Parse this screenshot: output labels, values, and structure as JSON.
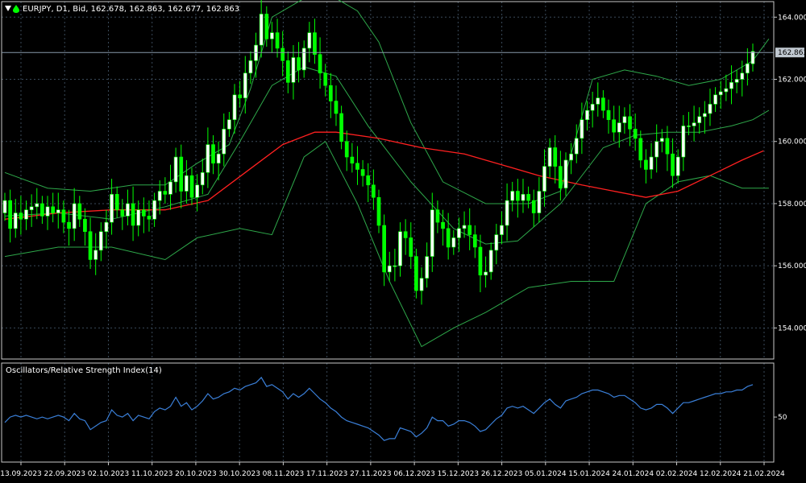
{
  "header": {
    "title": "EURJPY, D1, Bid, 162.678, 162.863, 162.677, 162.863",
    "arrow_icon": "triangle-down-icon",
    "status_icon": "green-drop-icon"
  },
  "colors": {
    "background": "#000000",
    "grid": "#3a4a5a",
    "frame": "#c8c8c8",
    "bull": "#ffffff",
    "bear": "#00ff00",
    "bollinger": "#2ea84a",
    "moving_average": "#ff2020",
    "rsi": "#3a7fd8",
    "price_line": "#8899aa",
    "price_tag_bg": "#c0c8d0"
  },
  "chart_data": [
    {
      "type": "candlestick",
      "symbol": "EURJPY",
      "timeframe": "D1",
      "ylim": [
        153.0,
        164.5
      ],
      "yticks": [
        "164.000",
        "162.000",
        "160.000",
        "158.000",
        "156.000",
        "154.000"
      ],
      "current_price": "162.863",
      "x_labels": [
        "13.09.2023",
        "22.09.2023",
        "02.10.2023",
        "11.10.2023",
        "20.10.2023",
        "30.10.2023",
        "08.11.2023",
        "17.11.2023",
        "27.11.2023",
        "06.12.2023",
        "15.12.2023",
        "26.12.2023",
        "05.01.2024",
        "15.01.2024",
        "24.01.2024",
        "02.02.2024",
        "12.02.2024",
        "21.02.2024"
      ],
      "closes": [
        158.1,
        157.2,
        157.7,
        157.5,
        157.8,
        157.9,
        158.0,
        157.6,
        157.9,
        157.7,
        157.8,
        157.4,
        157.2,
        158.0,
        157.5,
        157.1,
        156.2,
        156.5,
        157.1,
        157.4,
        158.3,
        157.8,
        157.6,
        158.0,
        157.3,
        157.8,
        157.6,
        157.5,
        158.1,
        158.4,
        158.3,
        158.7,
        159.5,
        158.4,
        158.9,
        158.2,
        158.6,
        159.0,
        159.9,
        159.3,
        159.6,
        160.4,
        160.7,
        161.5,
        161.4,
        162.2,
        162.6,
        163.1,
        164.1,
        163.3,
        163.5,
        163.0,
        162.6,
        161.9,
        162.7,
        162.3,
        163.0,
        163.5,
        162.8,
        162.2,
        161.8,
        161.3,
        160.9,
        160.0,
        159.5,
        159.3,
        159.1,
        158.9,
        158.6,
        158.2,
        157.3,
        155.8,
        156.0,
        156.0,
        157.1,
        156.9,
        156.3,
        155.2,
        155.6,
        156.3,
        157.8,
        157.4,
        157.2,
        156.6,
        156.9,
        157.2,
        157.3,
        157.0,
        156.6,
        155.7,
        155.8,
        156.5,
        157.0,
        157.3,
        158.1,
        158.4,
        158.1,
        158.3,
        158.1,
        157.7,
        158.4,
        159.2,
        159.8,
        159.2,
        158.5,
        159.4,
        159.6,
        160.1,
        160.7,
        161.0,
        161.2,
        161.4,
        161.0,
        160.7,
        160.3,
        160.6,
        160.8,
        160.4,
        160.1,
        159.4,
        159.1,
        159.5,
        160.0,
        160.1,
        159.6,
        158.9,
        159.5,
        160.5,
        160.5,
        160.6,
        160.8,
        160.9,
        161.2,
        161.5,
        161.6,
        161.7,
        161.9,
        162.0,
        162.2,
        162.5,
        162.9
      ],
      "ma": {
        "start": 157.5,
        "points": [
          [
            0,
            157.5
          ],
          [
            10,
            157.7
          ],
          [
            20,
            157.8
          ],
          [
            30,
            157.8
          ],
          [
            38,
            158.1
          ],
          [
            45,
            159.0
          ],
          [
            52,
            159.9
          ],
          [
            58,
            160.3
          ],
          [
            62,
            160.3
          ],
          [
            70,
            160.1
          ],
          [
            78,
            159.8
          ],
          [
            86,
            159.6
          ],
          [
            94,
            159.2
          ],
          [
            100,
            158.9
          ],
          [
            108,
            158.6
          ],
          [
            114,
            158.4
          ],
          [
            120,
            158.2
          ],
          [
            126,
            158.4
          ],
          [
            132,
            158.9
          ],
          [
            138,
            159.4
          ],
          [
            142,
            159.7
          ]
        ]
      },
      "bollinger_upper": [
        [
          0,
          159.0
        ],
        [
          8,
          158.5
        ],
        [
          16,
          158.4
        ],
        [
          24,
          158.6
        ],
        [
          30,
          158.6
        ],
        [
          36,
          159.3
        ],
        [
          42,
          159.9
        ],
        [
          46,
          161.7
        ],
        [
          50,
          164.0
        ],
        [
          56,
          164.6
        ],
        [
          62,
          164.6
        ],
        [
          66,
          164.2
        ],
        [
          70,
          163.2
        ],
        [
          76,
          160.6
        ],
        [
          82,
          158.7
        ],
        [
          90,
          158.0
        ],
        [
          98,
          158.0
        ],
        [
          104,
          158.4
        ],
        [
          110,
          162.0
        ],
        [
          116,
          162.3
        ],
        [
          122,
          162.1
        ],
        [
          128,
          161.8
        ],
        [
          134,
          162.0
        ],
        [
          140,
          162.6
        ],
        [
          143,
          163.3
        ]
      ],
      "bollinger_mid": [
        [
          0,
          157.6
        ],
        [
          10,
          157.7
        ],
        [
          20,
          157.5
        ],
        [
          30,
          157.9
        ],
        [
          38,
          158.3
        ],
        [
          44,
          160.0
        ],
        [
          50,
          161.8
        ],
        [
          56,
          162.4
        ],
        [
          62,
          162.1
        ],
        [
          68,
          160.5
        ],
        [
          76,
          158.7
        ],
        [
          84,
          157.2
        ],
        [
          90,
          156.7
        ],
        [
          96,
          156.8
        ],
        [
          104,
          158.0
        ],
        [
          112,
          159.8
        ],
        [
          118,
          160.2
        ],
        [
          124,
          160.3
        ],
        [
          130,
          160.3
        ],
        [
          136,
          160.5
        ],
        [
          140,
          160.7
        ],
        [
          143,
          161.0
        ]
      ],
      "bollinger_lower": [
        [
          0,
          156.3
        ],
        [
          10,
          156.6
        ],
        [
          20,
          156.6
        ],
        [
          30,
          156.2
        ],
        [
          36,
          156.9
        ],
        [
          44,
          157.2
        ],
        [
          50,
          157.0
        ],
        [
          56,
          159.5
        ],
        [
          60,
          160.0
        ],
        [
          66,
          158.0
        ],
        [
          72,
          155.5
        ],
        [
          78,
          153.4
        ],
        [
          84,
          154.0
        ],
        [
          90,
          154.5
        ],
        [
          98,
          155.3
        ],
        [
          106,
          155.5
        ],
        [
          114,
          155.5
        ],
        [
          120,
          158.0
        ],
        [
          126,
          158.7
        ],
        [
          132,
          158.9
        ],
        [
          138,
          158.5
        ],
        [
          143,
          158.5
        ]
      ]
    },
    {
      "type": "line",
      "title": "Oscillators/Relative Strength Index(14)",
      "level_label": "50",
      "level": 50,
      "ylim": [
        25,
        80
      ],
      "values": [
        47,
        50,
        51,
        50,
        51,
        50,
        49,
        50,
        49,
        50,
        51,
        50,
        48,
        52,
        49,
        48,
        43,
        45,
        47,
        48,
        54,
        51,
        50,
        52,
        48,
        51,
        50,
        49,
        53,
        55,
        54,
        56,
        61,
        56,
        58,
        54,
        56,
        59,
        63,
        60,
        61,
        63,
        64,
        66,
        65,
        67,
        68,
        69,
        72,
        67,
        68,
        66,
        64,
        60,
        63,
        61,
        63,
        66,
        63,
        60,
        58,
        55,
        53,
        50,
        48,
        47,
        46,
        45,
        44,
        42,
        40,
        37,
        38,
        38,
        44,
        43,
        42,
        39,
        41,
        44,
        50,
        48,
        48,
        45,
        46,
        48,
        48,
        47,
        45,
        42,
        43,
        46,
        49,
        51,
        55,
        56,
        55,
        56,
        54,
        52,
        55,
        58,
        60,
        57,
        55,
        59,
        60,
        61,
        63,
        64,
        65,
        65,
        64,
        63,
        61,
        62,
        62,
        60,
        58,
        55,
        54,
        55,
        57,
        57,
        55,
        52,
        55,
        58,
        58,
        59,
        60,
        61,
        62,
        63,
        63,
        64,
        64,
        65,
        65,
        67,
        68
      ]
    }
  ]
}
